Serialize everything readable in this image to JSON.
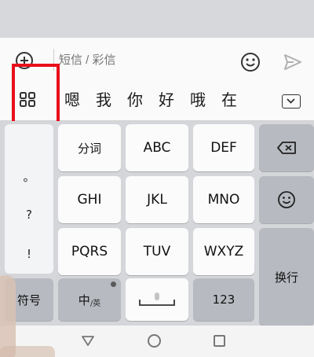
{
  "compose": {
    "input_placeholder": "短信 / 彩信"
  },
  "candidates": [
    "嗯",
    "我",
    "你",
    "好",
    "哦",
    "在"
  ],
  "keyboard": {
    "row1": [
      "分词",
      "ABC",
      "DEF"
    ],
    "row2": [
      "GHI",
      "JKL",
      "MNO"
    ],
    "row3": [
      "PQRS",
      "TUV",
      "WXYZ"
    ],
    "punctuation": [
      "。",
      "?",
      "!"
    ],
    "symbols_label": "符号",
    "lang_main": "中",
    "lang_sub": "/英",
    "numbers_label": "123",
    "enter_label": "换行"
  },
  "colors": {
    "highlight": "#e8101a",
    "send_icon": "#b0b0b0"
  },
  "icons": {
    "add": "plus-circle-icon",
    "emoji": "smiley-icon",
    "send": "send-arrow-icon",
    "apps": "grid-icon",
    "collapse": "chevron-down-icon",
    "backspace": "backspace-icon",
    "mic": "microphone-icon"
  }
}
